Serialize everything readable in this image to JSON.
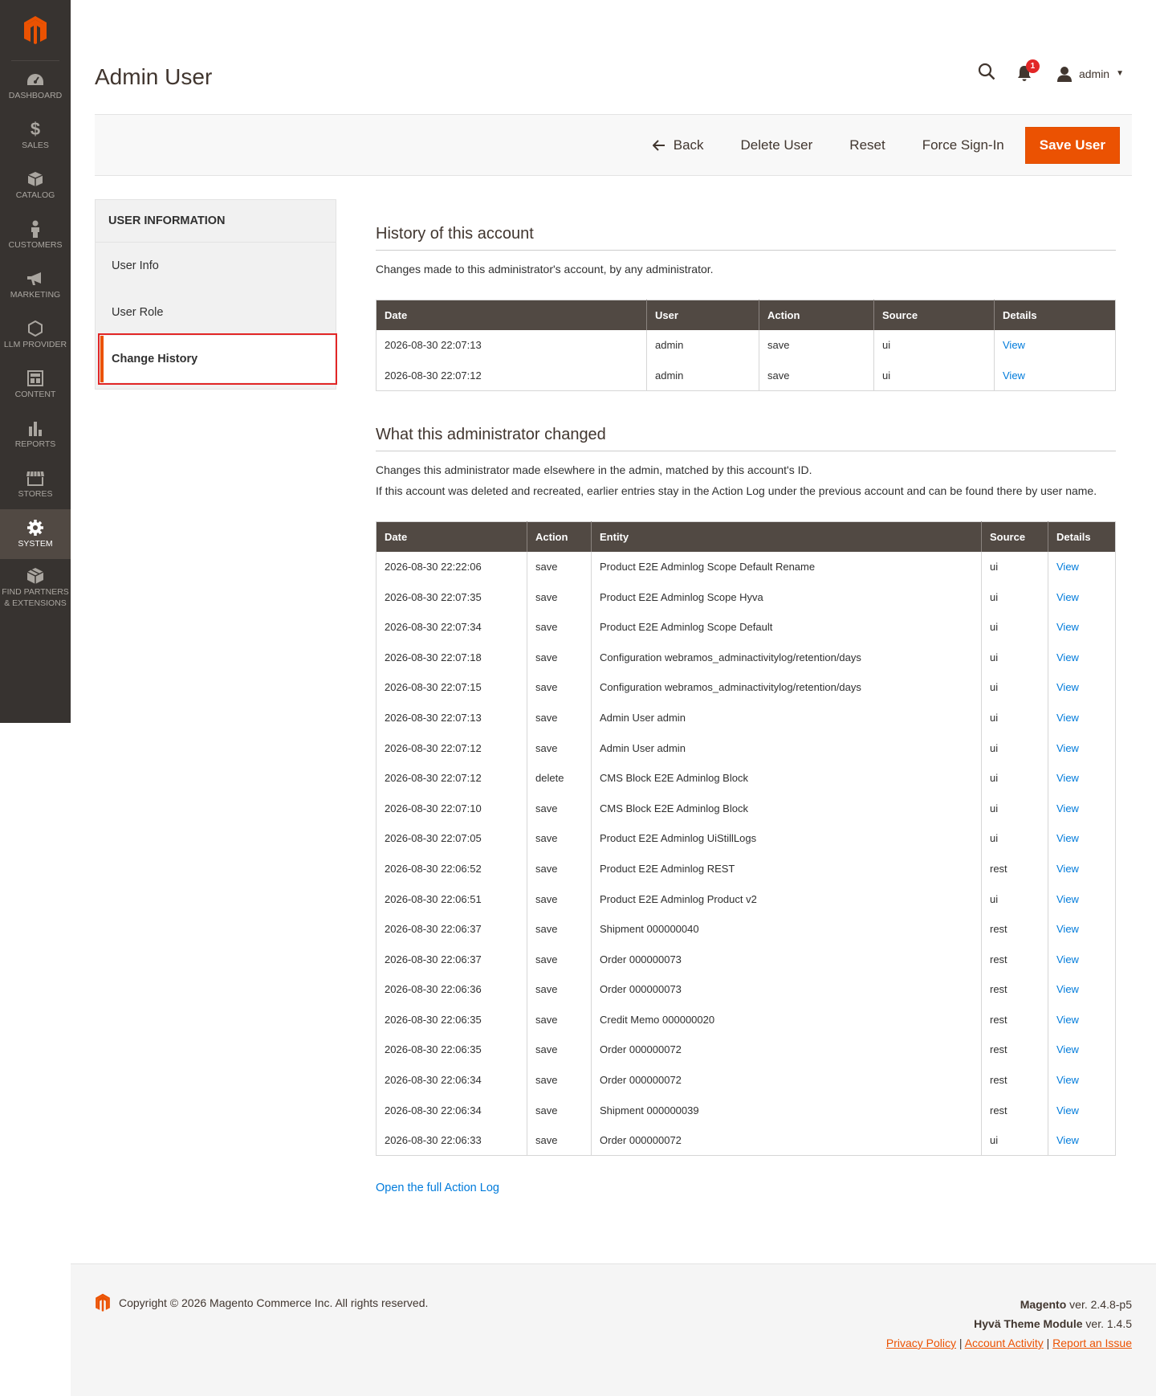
{
  "sidebar": {
    "items": [
      {
        "label": "DASHBOARD",
        "icon": "dashboard-icon"
      },
      {
        "label": "SALES",
        "icon": "dollar-icon"
      },
      {
        "label": "CATALOG",
        "icon": "box-icon"
      },
      {
        "label": "CUSTOMERS",
        "icon": "person-icon"
      },
      {
        "label": "MARKETING",
        "icon": "megaphone-icon"
      },
      {
        "label": "LLM PROVIDER",
        "icon": "hexagon-icon"
      },
      {
        "label": "CONTENT",
        "icon": "layout-icon"
      },
      {
        "label": "REPORTS",
        "icon": "bar-chart-icon"
      },
      {
        "label": "STORES",
        "icon": "store-icon"
      },
      {
        "label": "SYSTEM",
        "icon": "gear-icon"
      },
      {
        "label1": "FIND PARTNERS",
        "label2": "& EXTENSIONS",
        "icon": "cube-icon"
      }
    ]
  },
  "header": {
    "title": "Admin User",
    "notifications_count": "1",
    "user": "admin"
  },
  "actions": {
    "back": "Back",
    "delete": "Delete User",
    "reset": "Reset",
    "force_signin": "Force Sign-In",
    "save": "Save User"
  },
  "tabs": {
    "heading": "USER INFORMATION",
    "items": [
      "User Info",
      "User Role",
      "Change History"
    ]
  },
  "history": {
    "title": "History of this account",
    "desc": "Changes made to this administrator's account, by any administrator.",
    "columns": [
      "Date",
      "User",
      "Action",
      "Source",
      "Details"
    ],
    "rows": [
      [
        "2026-08-30 22:07:13",
        "admin",
        "save",
        "ui",
        "View"
      ],
      [
        "2026-08-30 22:07:12",
        "admin",
        "save",
        "ui",
        "View"
      ]
    ]
  },
  "changes": {
    "title": "What this administrator changed",
    "desc1": "Changes this administrator made elsewhere in the admin, matched by this account's ID.",
    "desc2": "If this account was deleted and recreated, earlier entries stay in the Action Log under the previous account and can be found there by user name.",
    "columns": [
      "Date",
      "Action",
      "Entity",
      "Source",
      "Details"
    ],
    "rows": [
      [
        "2026-08-30 22:22:06",
        "save",
        "Product E2E Adminlog Scope Default Rename",
        "ui",
        "View"
      ],
      [
        "2026-08-30 22:07:35",
        "save",
        "Product E2E Adminlog Scope Hyva",
        "ui",
        "View"
      ],
      [
        "2026-08-30 22:07:34",
        "save",
        "Product E2E Adminlog Scope Default",
        "ui",
        "View"
      ],
      [
        "2026-08-30 22:07:18",
        "save",
        "Configuration webramos_adminactivitylog/retention/days",
        "ui",
        "View"
      ],
      [
        "2026-08-30 22:07:15",
        "save",
        "Configuration webramos_adminactivitylog/retention/days",
        "ui",
        "View"
      ],
      [
        "2026-08-30 22:07:13",
        "save",
        "Admin User admin",
        "ui",
        "View"
      ],
      [
        "2026-08-30 22:07:12",
        "save",
        "Admin User admin",
        "ui",
        "View"
      ],
      [
        "2026-08-30 22:07:12",
        "delete",
        "CMS Block E2E Adminlog Block",
        "ui",
        "View"
      ],
      [
        "2026-08-30 22:07:10",
        "save",
        "CMS Block E2E Adminlog Block",
        "ui",
        "View"
      ],
      [
        "2026-08-30 22:07:05",
        "save",
        "Product E2E Adminlog UiStillLogs",
        "ui",
        "View"
      ],
      [
        "2026-08-30 22:06:52",
        "save",
        "Product E2E Adminlog REST",
        "rest",
        "View"
      ],
      [
        "2026-08-30 22:06:51",
        "save",
        "Product E2E Adminlog Product v2",
        "ui",
        "View"
      ],
      [
        "2026-08-30 22:06:37",
        "save",
        "Shipment 000000040",
        "rest",
        "View"
      ],
      [
        "2026-08-30 22:06:37",
        "save",
        "Order 000000073",
        "rest",
        "View"
      ],
      [
        "2026-08-30 22:06:36",
        "save",
        "Order 000000073",
        "rest",
        "View"
      ],
      [
        "2026-08-30 22:06:35",
        "save",
        "Credit Memo 000000020",
        "rest",
        "View"
      ],
      [
        "2026-08-30 22:06:35",
        "save",
        "Order 000000072",
        "rest",
        "View"
      ],
      [
        "2026-08-30 22:06:34",
        "save",
        "Order 000000072",
        "rest",
        "View"
      ],
      [
        "2026-08-30 22:06:34",
        "save",
        "Shipment 000000039",
        "rest",
        "View"
      ],
      [
        "2026-08-30 22:06:33",
        "save",
        "Order 000000072",
        "ui",
        "View"
      ]
    ],
    "full_log_link": "Open the full Action Log"
  },
  "footer": {
    "copyright": "Copyright © 2026 Magento Commerce Inc. All rights reserved.",
    "magento_name": "Magento",
    "magento_ver": " ver. 2.4.8-p5",
    "hyva_name": "Hyvä Theme Module",
    "hyva_ver": " ver. 1.4.5",
    "privacy": "Privacy Policy",
    "activity": " Account Activity",
    "report": "Report an Issue",
    "sep": " | "
  },
  "colors": {
    "accent": "#eb5202",
    "sidebar_bg": "#373330",
    "table_header": "#514943",
    "link": "#007bdb"
  }
}
